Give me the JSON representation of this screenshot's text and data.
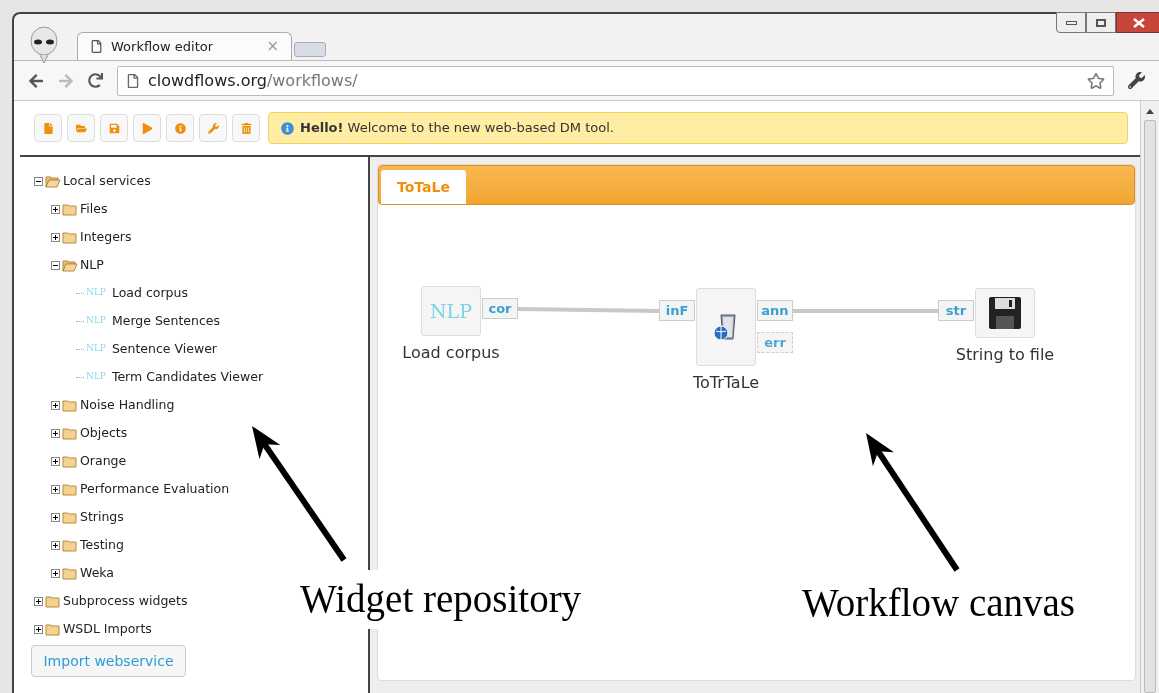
{
  "browser": {
    "tab_title": "Workflow editor",
    "tab_close": "×",
    "address": {
      "host": "clowdflows.org",
      "path": "/workflows/"
    }
  },
  "notice": {
    "text": "**Hello!** Welcome to the new web-based DM tool."
  },
  "tree": [
    {
      "label": "Local services",
      "expanded": true,
      "children": [
        {
          "label": "Files",
          "expanded": false
        },
        {
          "label": "Integers",
          "expanded": false
        },
        {
          "label": "NLP",
          "expanded": true,
          "children": [
            {
              "kind": "widget",
              "icon_text": "NLP",
              "label": "Load corpus"
            },
            {
              "kind": "widget",
              "icon_text": "NLP",
              "label": "Merge Sentences"
            },
            {
              "kind": "widget",
              "icon_text": "NLP",
              "label": "Sentence Viewer"
            },
            {
              "kind": "widget",
              "icon_text": "NLP",
              "label": "Term Candidates Viewer"
            }
          ]
        },
        {
          "label": "Noise Handling",
          "expanded": false
        },
        {
          "label": "Objects",
          "expanded": false
        },
        {
          "label": "Orange",
          "expanded": false
        },
        {
          "label": "Performance Evaluation",
          "expanded": false
        },
        {
          "label": "Strings",
          "expanded": false
        },
        {
          "label": "Testing",
          "expanded": false
        },
        {
          "label": "Weka",
          "expanded": false
        }
      ]
    },
    {
      "label": "Subprocess widgets",
      "expanded": false
    },
    {
      "label": "WSDL Imports",
      "expanded": false
    }
  ],
  "import_button": "Import webservice",
  "workflow": {
    "tabs": [
      {
        "label": "ToTaLe",
        "selected": true
      }
    ],
    "nodes": [
      {
        "kind": "text",
        "icon_text": "NLP",
        "label": "Load corpus",
        "outputs": [
          {
            "label": "cor",
            "connected": true
          }
        ]
      },
      {
        "kind": "service",
        "label": "ToTrTaLe",
        "inputs": [
          {
            "label": "inF",
            "connected": true
          }
        ],
        "outputs": [
          {
            "label": "ann",
            "connected": true
          },
          {
            "label": "err",
            "connected": false
          }
        ]
      },
      {
        "kind": "save",
        "label": "String to file",
        "inputs": [
          {
            "label": "str",
            "connected": true
          }
        ]
      }
    ]
  },
  "annotations": [
    {
      "text": "Widget repository"
    },
    {
      "text": "Workflow canvas"
    }
  ]
}
